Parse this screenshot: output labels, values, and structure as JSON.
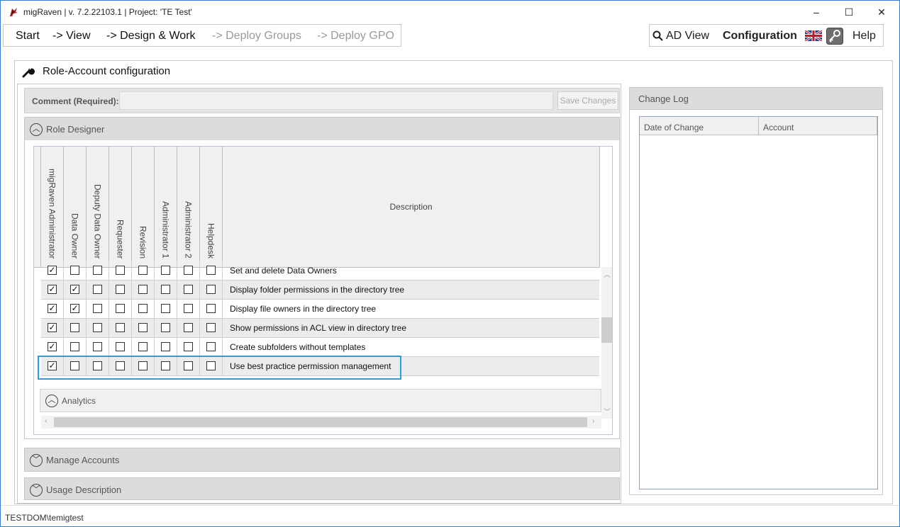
{
  "window": {
    "title": "migRaven | v. 7.2.22103.1 | Project: 'TE Test'",
    "minimize": "–",
    "maximize": "☐",
    "close": "✕"
  },
  "menu": {
    "start": "Start",
    "view": "-> View",
    "design_work": "-> Design & Work",
    "deploy_groups": "-> Deploy Groups",
    "deploy_gpo": "-> Deploy GPO"
  },
  "rightmenu": {
    "ad_view": "AD View",
    "configuration": "Configuration",
    "help": "Help"
  },
  "panel": {
    "title": "Role-Account configuration"
  },
  "comment": {
    "label": "Comment (Required):",
    "value": "",
    "save_label": "Save Changes"
  },
  "sections": {
    "role_designer": "Role Designer",
    "analytics": "Analytics",
    "manage_accounts": "Manage Accounts",
    "usage_description": "Usage Description"
  },
  "role_columns": [
    "migRaven Administrator",
    "Data Owner",
    "Deputy Data Owner",
    "Requester",
    "Revision",
    "Administrator 1",
    "Administrator 2",
    "Helpdesk"
  ],
  "description_header": "Description",
  "rows": [
    {
      "description": "Set and delete Data Owners",
      "checks": [
        true,
        false,
        false,
        false,
        false,
        false,
        false,
        false
      ]
    },
    {
      "description": "Display folder permissions in the directory tree",
      "checks": [
        true,
        true,
        false,
        false,
        false,
        false,
        false,
        false
      ]
    },
    {
      "description": "Display file owners in the directory tree",
      "checks": [
        true,
        true,
        false,
        false,
        false,
        false,
        false,
        false
      ]
    },
    {
      "description": "Show permissions in ACL view in directory tree",
      "checks": [
        true,
        false,
        false,
        false,
        false,
        false,
        false,
        false
      ]
    },
    {
      "description": "Create subfolders without templates",
      "checks": [
        true,
        false,
        false,
        false,
        false,
        false,
        false,
        false
      ]
    },
    {
      "description": "Use best practice permission management",
      "checks": [
        true,
        false,
        false,
        false,
        false,
        false,
        false,
        false
      ]
    }
  ],
  "changelog": {
    "title": "Change Log",
    "col_date": "Date of Change",
    "col_account": "Account"
  },
  "status": {
    "user": "TESTDOM\\temigtest"
  },
  "colors": {
    "highlight": "#27a0e0",
    "window_border": "#3a7bd5"
  }
}
